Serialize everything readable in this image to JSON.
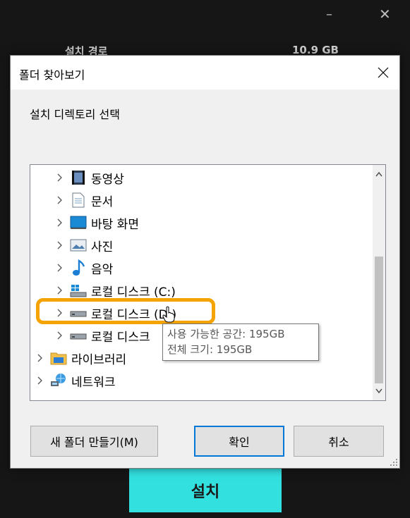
{
  "background": {
    "minimize_glyph": "–",
    "close_glyph": "✕",
    "path_label": "설치 경로",
    "size": "10.9 GB",
    "install_button": "설치"
  },
  "dialog": {
    "title": "폴더 찾아보기",
    "instruction": "설치 디렉토리 선택",
    "tree": [
      {
        "label": "동영상",
        "icon": "video-folder-icon"
      },
      {
        "label": "문서",
        "icon": "documents-folder-icon"
      },
      {
        "label": "바탕 화면",
        "icon": "desktop-folder-icon"
      },
      {
        "label": "사진",
        "icon": "pictures-folder-icon"
      },
      {
        "label": "음악",
        "icon": "music-folder-icon"
      },
      {
        "label": "로컬 디스크 (C:)",
        "icon": "windows-drive-icon"
      },
      {
        "label": "로컬 디스크 (D:)",
        "icon": "drive-icon"
      },
      {
        "label": "로컬 디스크",
        "icon": "drive-icon"
      },
      {
        "label": "라이브러리",
        "icon": "library-icon"
      },
      {
        "label": "네트워크",
        "icon": "network-icon"
      }
    ],
    "tooltip": {
      "line1": "사용 가능한 공간: 195GB",
      "line2": "전체 크기: 195GB"
    },
    "buttons": {
      "new_folder": "새 폴더 만들기(M)",
      "ok": "확인",
      "cancel": "취소"
    }
  },
  "colors": {
    "highlight": "#f5a300",
    "install_button": "#33e0e0",
    "ok_border": "#0078d7"
  }
}
